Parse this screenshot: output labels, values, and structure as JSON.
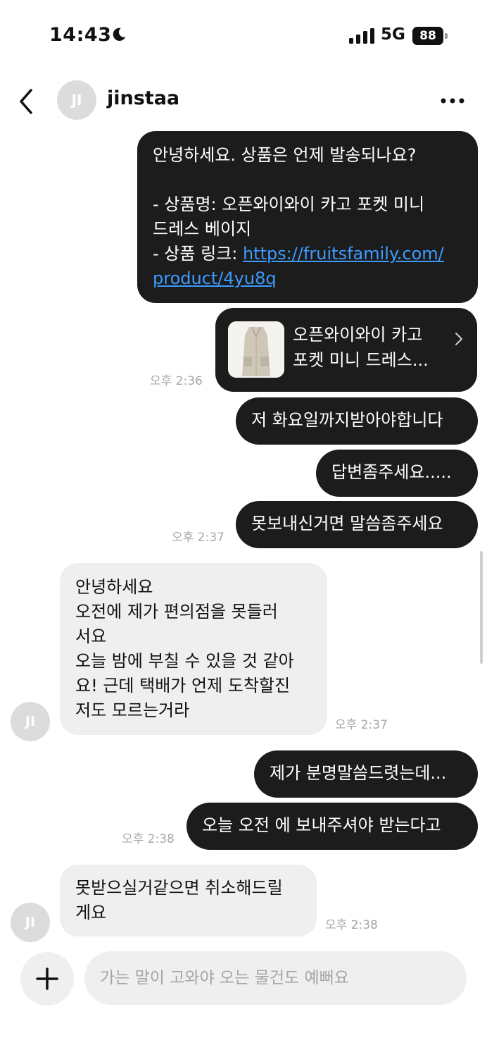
{
  "status_bar": {
    "time": "14:43",
    "network": "5G",
    "battery": "88"
  },
  "header": {
    "avatar_initials": "JI",
    "username": "jinstaa"
  },
  "messages": {
    "m1_line1": "안녕하세요. 상품은 언제 발송되나요?",
    "m1_line2": "- 상품명: 오픈와이와이 카고 포켓 미니",
    "m1_line3": "드레스 베이지",
    "m1_link_prefix": "- 상품 링크: ",
    "m1_link_part1": "https://fruitsfamily.com/",
    "m1_link_part2": "product/4yu8q",
    "product_card_title": "오픈와이와이 카고\n포켓 미니 드레스...",
    "ts1": "오후 2:36",
    "m2": "저 화요일까지받아야합니다",
    "m3": "답변좀주세요.....",
    "m4": "못보내신거면 말씀좀주세요",
    "ts2": "오후 2:37",
    "in1": "안녕하세요\n오전에 제가 편의점을 못들러\n서요\n오늘 밤에 부칠 수 있을 것 같아\n요! 근데 택배가 언제 도착할진\n저도 모르는거라",
    "in1_avatar": "JI",
    "ts3": "오후 2:37",
    "m5": "제가 분명말씀드렷는데...",
    "m6": "오늘 오전 에 보내주셔야 받는다고",
    "ts4": "오후 2:38",
    "in2": "못받으실거같으면 취소해드릴\n게요",
    "in2_avatar": "JI",
    "ts5": "오후 2:38"
  },
  "composer": {
    "placeholder": "가는 말이 고와야 오는 물건도 예뻐요"
  },
  "colors": {
    "outgoing_bubble": "#1c1c1c",
    "incoming_bubble": "#efefef",
    "link": "#3d9bff"
  },
  "icons": [
    "moon-icon",
    "signal-icon",
    "battery-icon",
    "back-chevron-icon",
    "more-options-icon",
    "chevron-right-icon",
    "plus-icon"
  ]
}
